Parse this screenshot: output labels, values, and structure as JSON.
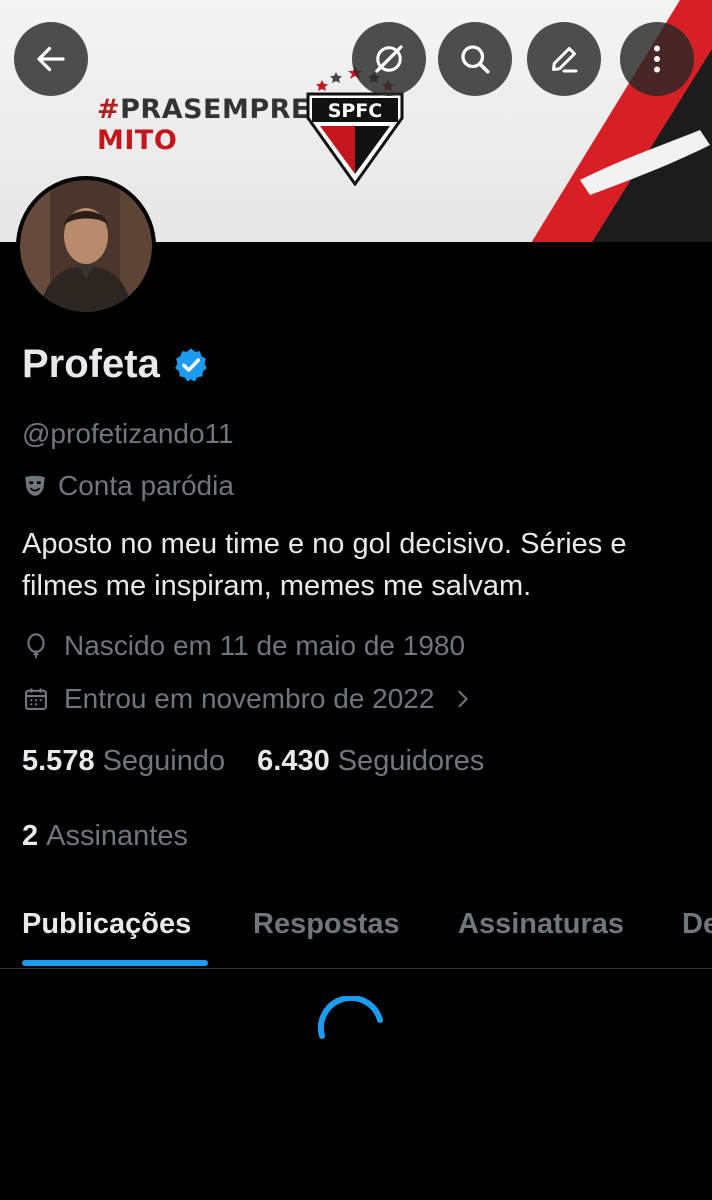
{
  "colors": {
    "background": "#000000",
    "text_primary": "#e7e9ea",
    "text_secondary": "#71767b",
    "accent": "#1d9bf0",
    "banner_red": "#c4161c"
  },
  "banner": {
    "hashtag_line": "PRASEMPRE",
    "hashtag_symbol": "#",
    "second_line": "MITO",
    "crest_text": "SPFC"
  },
  "topbar": {
    "back_icon": "arrow-left-icon",
    "grok_icon": "slash-circle-icon",
    "search_icon": "search-icon",
    "edit_icon": "pencil-icon",
    "more_icon": "more-vertical-icon"
  },
  "profile": {
    "name": "Profeta",
    "handle": "@profetizando11",
    "parody_label": "Conta paródia",
    "bio": "Aposto no meu time e no gol decisivo. Séries e filmes me inspiram, memes me salvam.",
    "birth": "Nascido em 11 de maio de 1980",
    "joined": "Entrou em novembro de 2022",
    "following_count": "5.578",
    "following_label": "Seguindo",
    "followers_count": "6.430",
    "followers_label": "Seguidores",
    "subscribers_count": "2",
    "subscribers_label": "Assinantes"
  },
  "tabs": [
    {
      "label": "Publicações"
    },
    {
      "label": "Respostas"
    },
    {
      "label": "Assinaturas"
    },
    {
      "label": "De"
    }
  ]
}
